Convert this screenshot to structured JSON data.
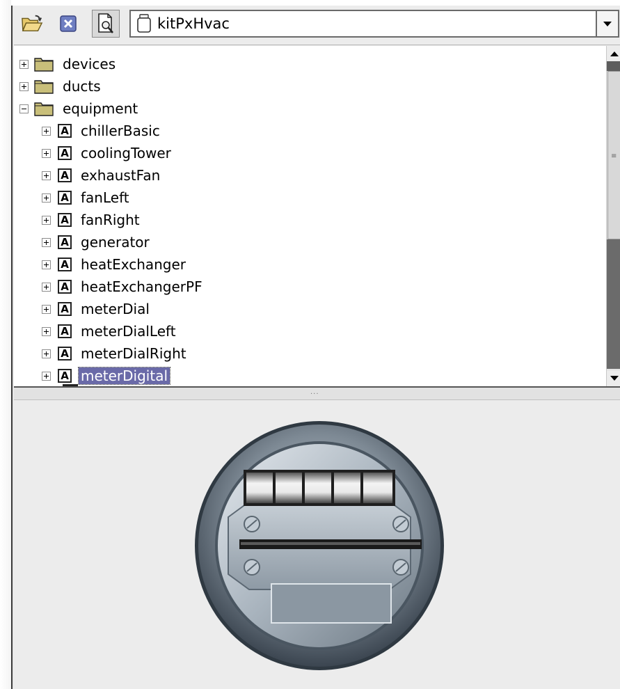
{
  "toolbar": {
    "buttons": [
      {
        "name": "open-folder",
        "icon": "open-folder-icon"
      },
      {
        "name": "close",
        "icon": "close-icon"
      },
      {
        "name": "find",
        "icon": "find-document-icon"
      }
    ],
    "module_select": {
      "value": "kitPxHvac",
      "icon": "jar-icon"
    }
  },
  "tree": {
    "folders": [
      {
        "label": "devices",
        "expanded": false
      },
      {
        "label": "ducts",
        "expanded": false
      },
      {
        "label": "equipment",
        "expanded": true
      }
    ],
    "items": [
      {
        "label": "chillerBasic"
      },
      {
        "label": "coolingTower"
      },
      {
        "label": "exhaustFan"
      },
      {
        "label": "fanLeft"
      },
      {
        "label": "fanRight"
      },
      {
        "label": "generator"
      },
      {
        "label": "heatExchanger"
      },
      {
        "label": "heatExchangerPF"
      },
      {
        "label": "meterDial"
      },
      {
        "label": "meterDialLeft"
      },
      {
        "label": "meterDialRight"
      },
      {
        "label": "meterDigital",
        "selected": true
      }
    ],
    "item_icon_letter": "A"
  },
  "preview": {
    "image": "digital-meter-image"
  },
  "colors": {
    "selection": "#6a6aa8",
    "folder": "#c9bf7a"
  }
}
